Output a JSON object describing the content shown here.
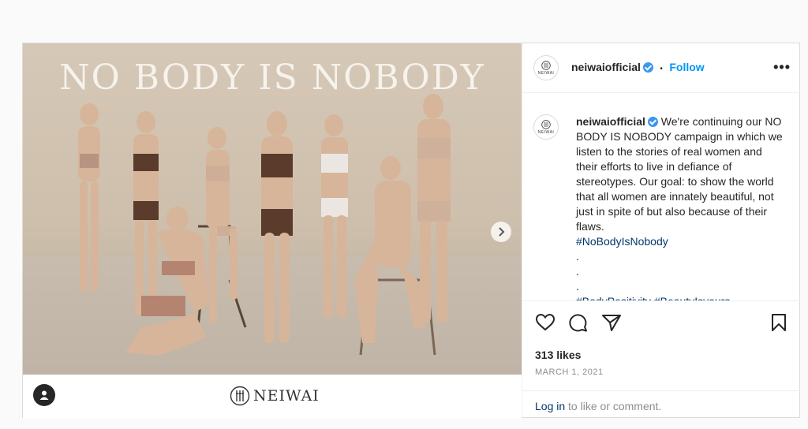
{
  "post": {
    "image_headline": "NO BODY IS NOBODY",
    "brand_logo_text": "NEIWAI",
    "avatar_text": "NEIWAI"
  },
  "header": {
    "username": "neiwaiofficial",
    "separator": "•",
    "follow_label": "Follow",
    "more_label": "•••"
  },
  "caption": {
    "username": "neiwaiofficial",
    "text": " We're continuing our NO BODY IS NOBODY campaign in which we listen to the stories of real women and their efforts to live in defiance of stereotypes. Our goal: to show the world that all women are innately beautiful, not just in spite of but also because of their flaws.",
    "hashtag": "#NoBodyIsNobody",
    "dots": [
      ".",
      ".",
      "."
    ],
    "cut_line": "#BodyPositivity #BeautyIsyours ..."
  },
  "actions": {
    "likes": "313 likes",
    "date": "MARCH 1, 2021"
  },
  "login": {
    "link": "Log in",
    "rest": " to like or comment."
  },
  "icons": {
    "like": "heart-icon",
    "comment": "comment-icon",
    "share": "share-icon",
    "save": "bookmark-icon",
    "next": "chevron-right-icon",
    "user": "user-icon",
    "verified": "verified-badge-icon"
  },
  "colors": {
    "accent": "#0095f6",
    "hashtag": "#00376b",
    "verified": "#3897f0",
    "muted": "#8e8e8e"
  }
}
